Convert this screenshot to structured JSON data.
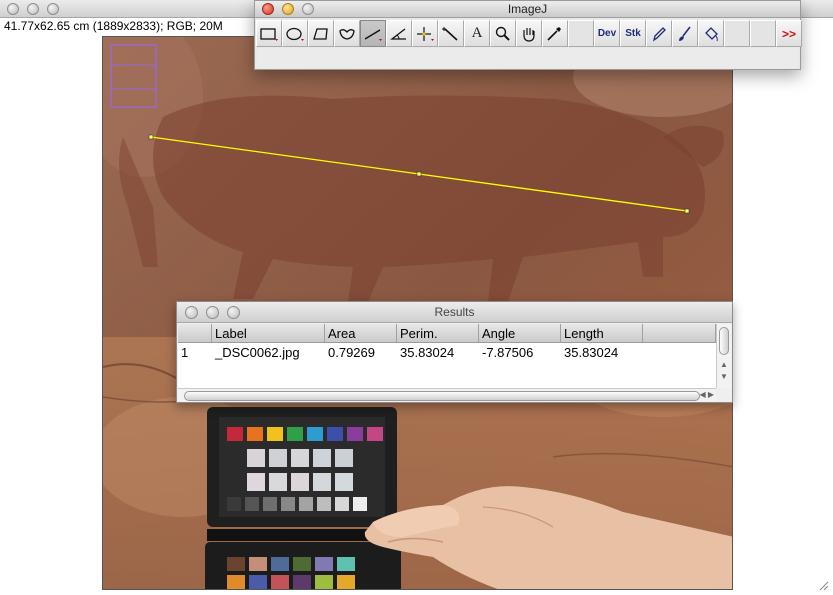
{
  "image_window": {
    "info": "41.77x62.65 cm (1889x2833); RGB; 20M"
  },
  "toolbar_window": {
    "title": "ImageJ",
    "dev_label": "Dev",
    "stk_label": "Stk",
    "more_label": ">>",
    "text_tool_label": "A"
  },
  "results_window": {
    "title": "Results",
    "columns": [
      "",
      "Label",
      "Area",
      "Perim.",
      "Angle",
      "Length",
      ""
    ],
    "rows": [
      [
        "1",
        "_DSC0062.jpg",
        "0.79269",
        "35.83024",
        "-7.87506",
        "35.83024",
        ""
      ]
    ]
  },
  "colors": {
    "selection_line": "#ffff00",
    "roi_box": "#9966ff",
    "rock": "#8a5a43"
  }
}
